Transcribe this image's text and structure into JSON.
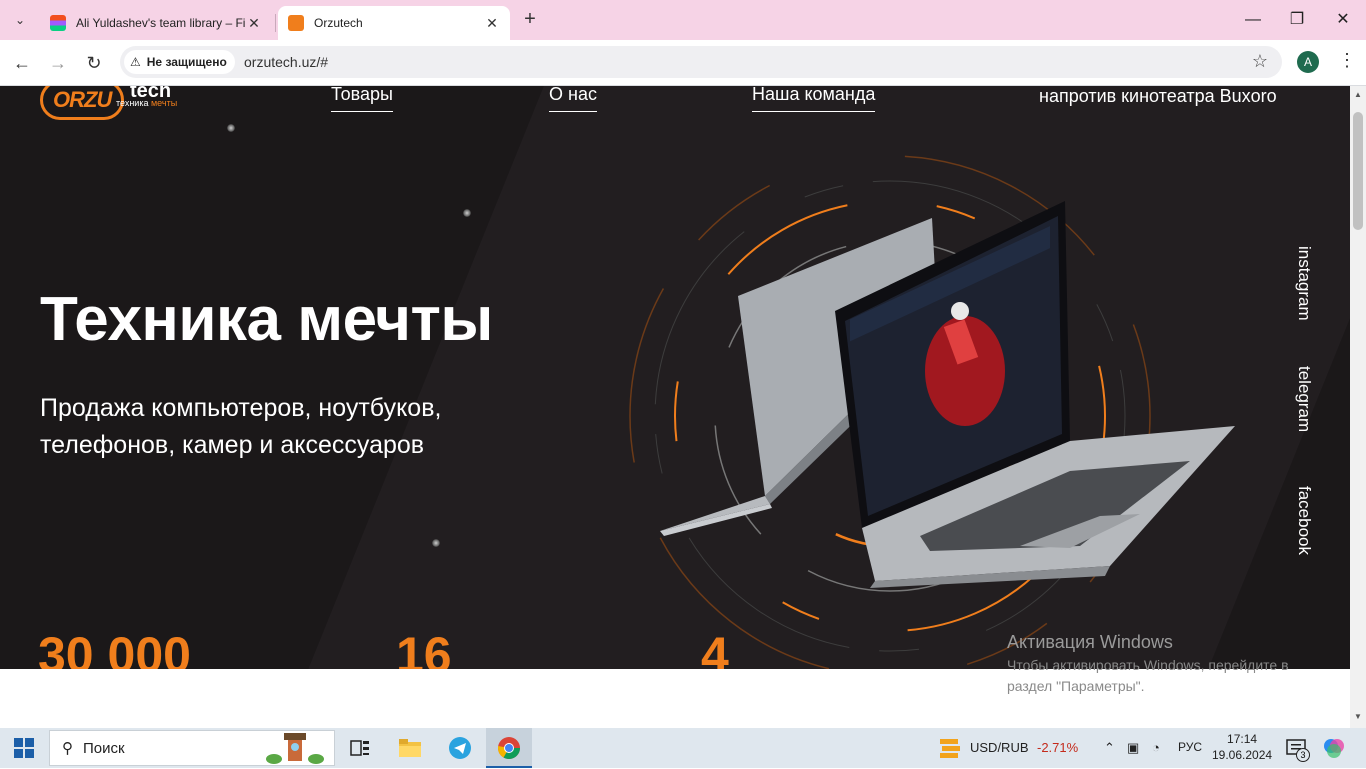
{
  "browser": {
    "tabs": [
      {
        "title": "Ali Yuldashev's team library – Fi",
        "active": false
      },
      {
        "title": "Orzutech",
        "active": true
      }
    ],
    "security_label": "Не защищено",
    "url": "orzutech.uz/#",
    "profile_initial": "A"
  },
  "site": {
    "logo": {
      "brand": "ORZU",
      "tech": "tech",
      "tagline_a": "техника",
      "tagline_b": "мечты"
    },
    "nav": [
      "Товары",
      "О нас",
      "Наша команда"
    ],
    "address": "напротив кинотеатра Buxoro",
    "hero_title": "Техника мечты",
    "hero_subtitle": "Продажа компьютеров, ноутбуков, телефонов, камер и аксессуаров",
    "stats": [
      "30 000",
      "16",
      "4"
    ],
    "social": [
      "instagram",
      "telegram",
      "facebook"
    ],
    "accent_color": "#f07e1c",
    "background_color": "#1b1819"
  },
  "windows_activation": {
    "title": "Активация Windows",
    "text": "Чтобы активировать Windows, перейдите в раздел \"Параметры\"."
  },
  "taskbar": {
    "search_label": "Поиск",
    "currency_label": "USD/RUB",
    "currency_change": "-2.71%",
    "language": "РУС",
    "time": "17:14",
    "date": "19.06.2024",
    "notification_count": "3"
  }
}
